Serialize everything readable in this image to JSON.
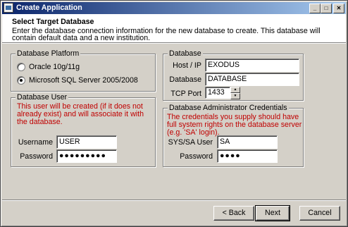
{
  "window": {
    "title": "Create Application"
  },
  "header": {
    "title": "Select Target Database",
    "description": "Enter the database connection information for the new database to create.  This database will contain default data and a new institution."
  },
  "platform": {
    "legend": "Database Platform",
    "options": [
      {
        "label": "Oracle 10g/11g",
        "checked": false
      },
      {
        "label": "Microsoft SQL Server 2005/2008",
        "checked": true
      }
    ]
  },
  "database": {
    "legend": "Database",
    "host_label": "Host / IP",
    "host_value": "EXODUS",
    "db_label": "Database",
    "db_value": "DATABASE",
    "port_label": "TCP Port",
    "port_value": "1433"
  },
  "db_user": {
    "legend": "Database User",
    "note": "This user will be created (if it does not already exist) and will associate it with the database.",
    "username_label": "Username",
    "username_value": "USER",
    "password_label": "Password",
    "password_value": "●●●●●●●●●"
  },
  "admin": {
    "legend": "Database Administrator Credentials",
    "note": "The credentials you supply should have full system rights on the database server (e.g. 'SA' login).",
    "user_label": "SYS/SA User",
    "user_value": "SA",
    "password_label": "Password",
    "password_value": "●●●●"
  },
  "buttons": {
    "back": "< Back",
    "next": "Next",
    "cancel": "Cancel"
  }
}
